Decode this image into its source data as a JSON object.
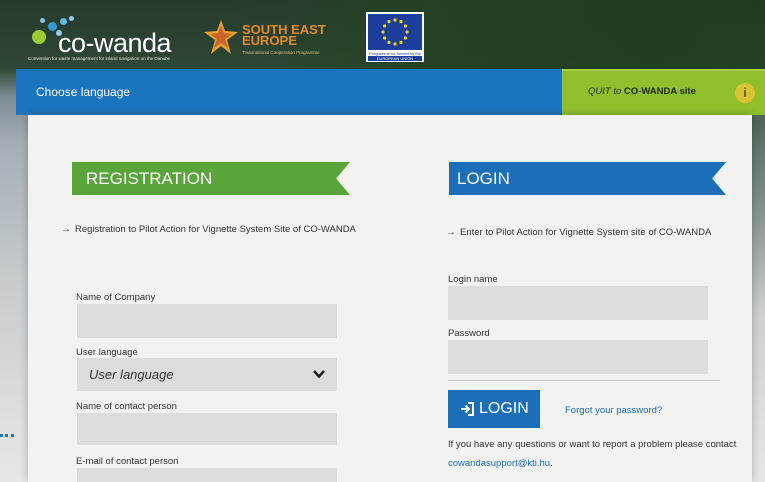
{
  "header": {
    "logo_name": "co-wanda",
    "logo_tagline": "Convention for waste management for inland navigation on the Danube",
    "see_title": "SOUTH EAST\nEUROPE",
    "see_subtitle": "Transnational Cooperation Programme",
    "eu_caption": "Programme co-funded by the",
    "eu_label": "EUROPEAN UNION"
  },
  "topbar": {
    "choose_language": "Choose language",
    "quit_prefix": "QUIT to",
    "quit_site": "CO-WANDA site",
    "info_icon": "info-icon"
  },
  "registration": {
    "title": "REGISTRATION",
    "intro": "Registration to Pilot Action for Vignette System Site of CO-WANDA",
    "fields": {
      "company_label": "Name of Company",
      "company_value": "",
      "language_label": "User language",
      "language_value": "User language",
      "contact_label": "Name of contact person",
      "contact_value": "",
      "email_label": "E-mail of contact person",
      "email_value": ""
    }
  },
  "login": {
    "title": "LOGIN",
    "intro": "Enter to Pilot Action for Vignette System site of CO-WANDA",
    "login_name_label": "Login name",
    "login_name_value": "",
    "password_label": "Password",
    "password_value": "",
    "button_label": "LOGIN",
    "forgot_link": "Forgot your password?",
    "help_text": "If you have any questions or want to report a problem please contact",
    "help_email": "cowandasupport@kti.hu",
    "help_end": "."
  },
  "colors": {
    "primary_blue": "#1b74be",
    "green": "#59a53b",
    "quit_green": "#8fbf2c",
    "field_gray": "#dcdcdc"
  }
}
